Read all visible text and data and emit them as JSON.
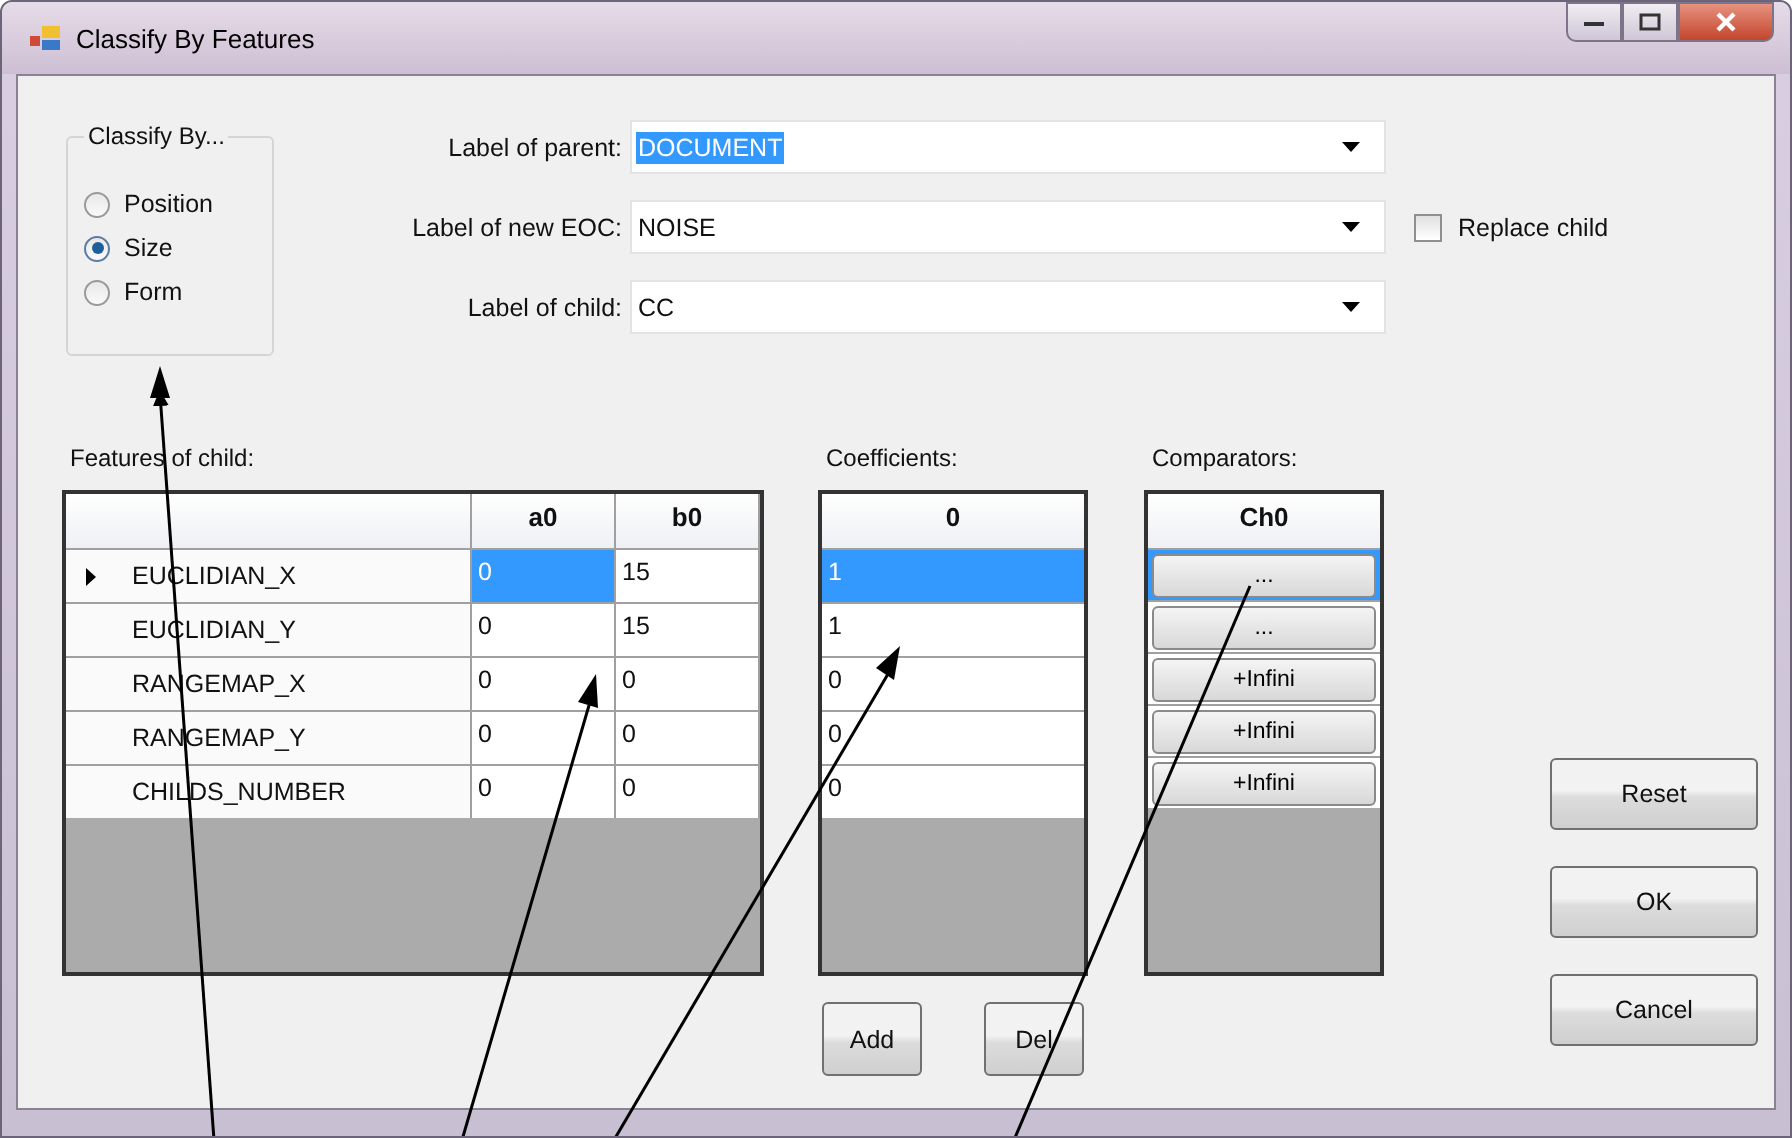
{
  "window": {
    "title": "Classify By Features"
  },
  "classify_by": {
    "title": "Classify By...",
    "options": [
      {
        "label": "Position",
        "selected": false
      },
      {
        "label": "Size",
        "selected": true
      },
      {
        "label": "Form",
        "selected": false
      }
    ]
  },
  "fields": [
    {
      "label": "Label of parent:",
      "value": "DOCUMENT",
      "highlighted": true
    },
    {
      "label": "Label of new EOC:",
      "value": "NOISE",
      "highlighted": false
    },
    {
      "label": "Label of child:",
      "value": "CC",
      "highlighted": false
    }
  ],
  "replace_child": {
    "label": "Replace child",
    "checked": false
  },
  "features": {
    "title": "Features of child:",
    "columns": [
      "a0",
      "b0"
    ],
    "rows": [
      {
        "name": "EUCLIDIAN_X",
        "current": true,
        "cells": [
          {
            "value": "0",
            "selected": true
          },
          {
            "value": "15",
            "selected": false
          }
        ]
      },
      {
        "name": "EUCLIDIAN_Y",
        "current": false,
        "cells": [
          {
            "value": "0",
            "selected": false
          },
          {
            "value": "15",
            "selected": false
          }
        ]
      },
      {
        "name": "RANGEMAP_X",
        "current": false,
        "cells": [
          {
            "value": "0",
            "selected": false
          },
          {
            "value": "0",
            "selected": false
          }
        ]
      },
      {
        "name": "RANGEMAP_Y",
        "current": false,
        "cells": [
          {
            "value": "0",
            "selected": false
          },
          {
            "value": "0",
            "selected": false
          }
        ]
      },
      {
        "name": "CHILDS_NUMBER",
        "current": false,
        "cells": [
          {
            "value": "0",
            "selected": false
          },
          {
            "value": "0",
            "selected": false
          }
        ]
      }
    ]
  },
  "coefficients": {
    "title": "Coefficients:",
    "column": "0",
    "rows": [
      {
        "value": "1",
        "selected": true
      },
      {
        "value": "1",
        "selected": false
      },
      {
        "value": "0",
        "selected": false
      },
      {
        "value": "0",
        "selected": false
      },
      {
        "value": "0",
        "selected": false
      }
    ]
  },
  "comparators": {
    "title": "Comparators:",
    "column": "Ch0",
    "rows": [
      {
        "label": "...",
        "selected": true
      },
      {
        "label": "...",
        "selected": false
      },
      {
        "label": "+Infini",
        "selected": false
      },
      {
        "label": "+Infini",
        "selected": false
      },
      {
        "label": "+Infini",
        "selected": false
      }
    ]
  },
  "coefficient_buttons": [
    "Add",
    "Del"
  ],
  "dialog_buttons": [
    "Reset",
    "OK",
    "Cancel"
  ]
}
